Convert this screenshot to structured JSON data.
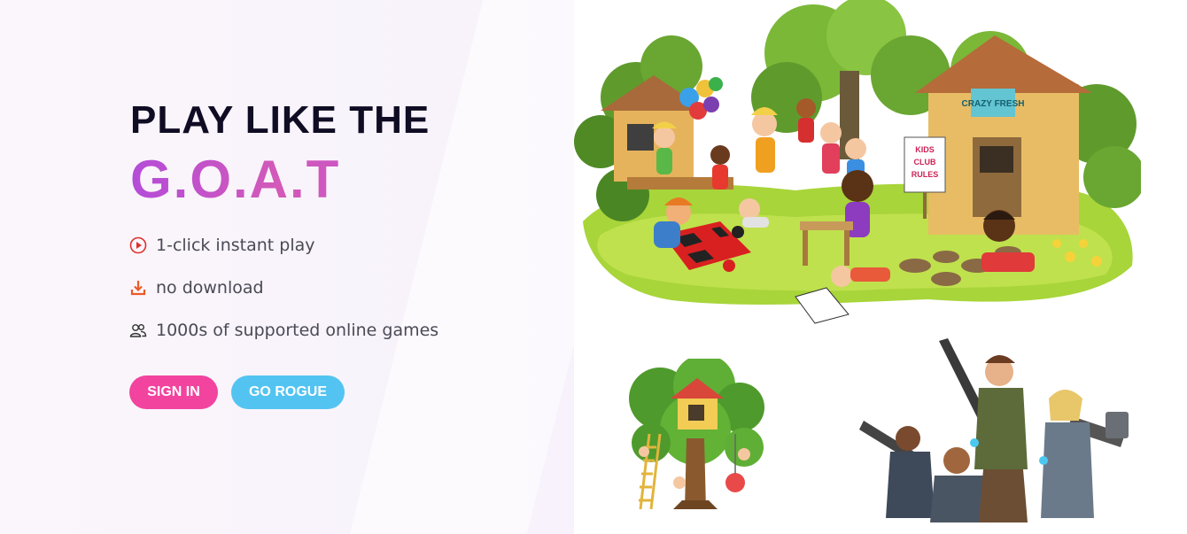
{
  "hero": {
    "headline_line1": "PLAY LIKE THE",
    "headline_line2": "G.O.A.T"
  },
  "features": [
    {
      "icon": "play-circle-icon",
      "text": "1-click instant play"
    },
    {
      "icon": "download-icon",
      "text": "no download"
    },
    {
      "icon": "users-icon",
      "text": "1000s of supported online games"
    }
  ],
  "buttons": {
    "signin_label": "SIGN IN",
    "rogue_label": "GO ROGUE"
  },
  "illustrations": {
    "clubhouse_sign": "KIDS CLUB RULES",
    "hut_sign": "CRAZY FRESH"
  },
  "colors": {
    "accent_pink": "#f2439f",
    "accent_blue": "#53c4f1",
    "headline_dark": "#0f0c24",
    "goat_gradient_start": "#b44cd9",
    "goat_gradient_end": "#c24fd2"
  }
}
